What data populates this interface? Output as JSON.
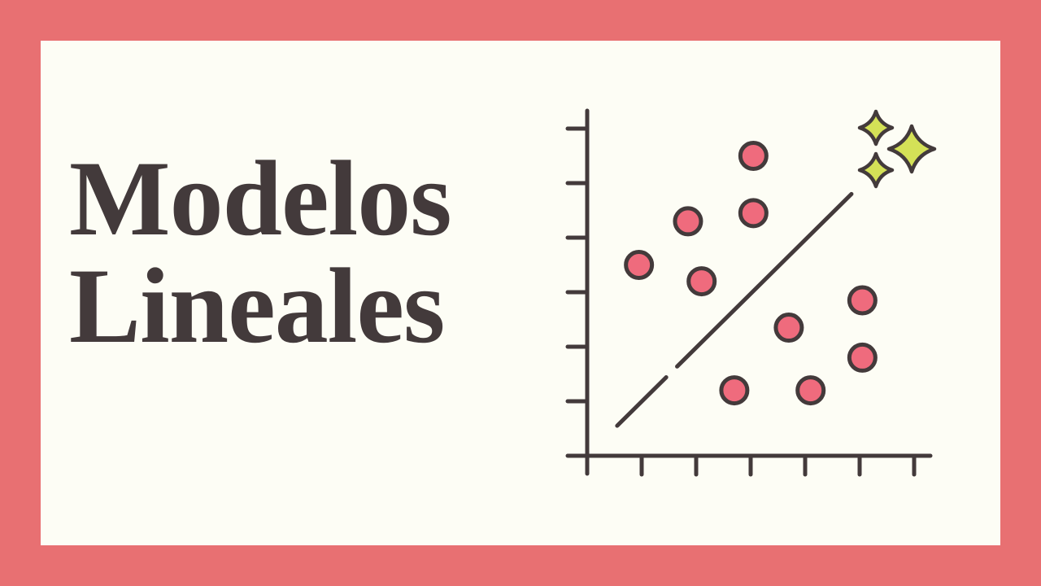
{
  "title": {
    "line1": "Modelos",
    "line2": "Lineales"
  },
  "colors": {
    "frame": "#e87072",
    "panel": "#fdfdf5",
    "ink": "#433a3b",
    "point_fill": "#ef6b7d",
    "sparkle_fill": "#d4e157"
  },
  "icons": [
    "sparkle-icon",
    "sparkle-icon",
    "sparkle-icon"
  ],
  "chart_data": {
    "type": "scatter",
    "title": "",
    "xlabel": "",
    "ylabel": "",
    "xlim": [
      0,
      6
    ],
    "ylim": [
      0,
      6
    ],
    "x_ticks": 7,
    "y_ticks": 6,
    "grid": false,
    "points": [
      {
        "x": 0.95,
        "y": 3.5
      },
      {
        "x": 1.85,
        "y": 4.3
      },
      {
        "x": 2.1,
        "y": 3.2
      },
      {
        "x": 3.05,
        "y": 5.5
      },
      {
        "x": 3.05,
        "y": 4.45
      },
      {
        "x": 2.7,
        "y": 1.2
      },
      {
        "x": 3.7,
        "y": 2.35
      },
      {
        "x": 4.1,
        "y": 1.2
      },
      {
        "x": 5.05,
        "y": 2.85
      },
      {
        "x": 5.05,
        "y": 1.8
      }
    ],
    "trendline": {
      "from": {
        "x": 0.55,
        "y": 0.55
      },
      "to": {
        "x": 4.85,
        "y": 4.8
      },
      "gap": {
        "from_x": 1.45,
        "to_x": 1.65
      }
    }
  }
}
